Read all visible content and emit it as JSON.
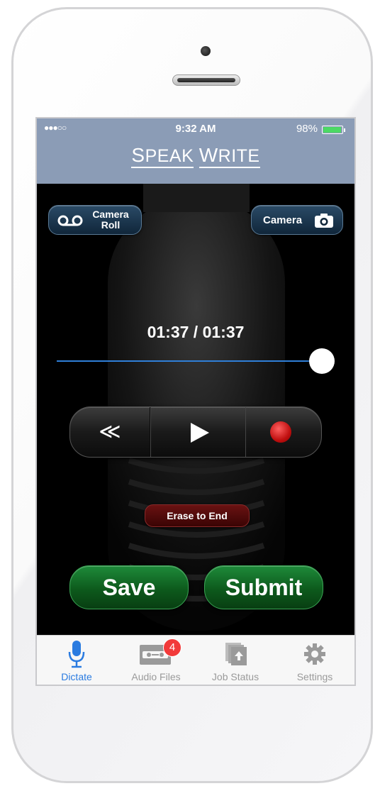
{
  "status_bar": {
    "signal": "●●●○○",
    "time": "9:32 AM",
    "battery_percent": "98%",
    "battery_level": 0.98
  },
  "header": {
    "logo_first_big": "S",
    "logo_first_rest": "PEAK",
    "logo_second_big": "W",
    "logo_second_rest": "RITE"
  },
  "buttons": {
    "camera_roll_line1": "Camera",
    "camera_roll_line2": "Roll",
    "camera": "Camera",
    "erase": "Erase to End",
    "save": "Save",
    "submit": "Submit"
  },
  "player": {
    "timer": "01:37 / 01:37",
    "position_fraction": 1.0,
    "rewind_glyph": "≪"
  },
  "tabbar": {
    "tabs": [
      {
        "label": "Dictate",
        "icon": "microphone-icon",
        "active": true
      },
      {
        "label": "Audio Files",
        "icon": "cassette-icon",
        "badge": "4"
      },
      {
        "label": "Job Status",
        "icon": "job-status-icon"
      },
      {
        "label": "Settings",
        "icon": "gear-icon"
      }
    ]
  },
  "colors": {
    "header_bg": "#8b9cb6",
    "accent_blue": "#2a7be0",
    "green_button": "#1e8a3a",
    "record_red": "#c01010"
  }
}
